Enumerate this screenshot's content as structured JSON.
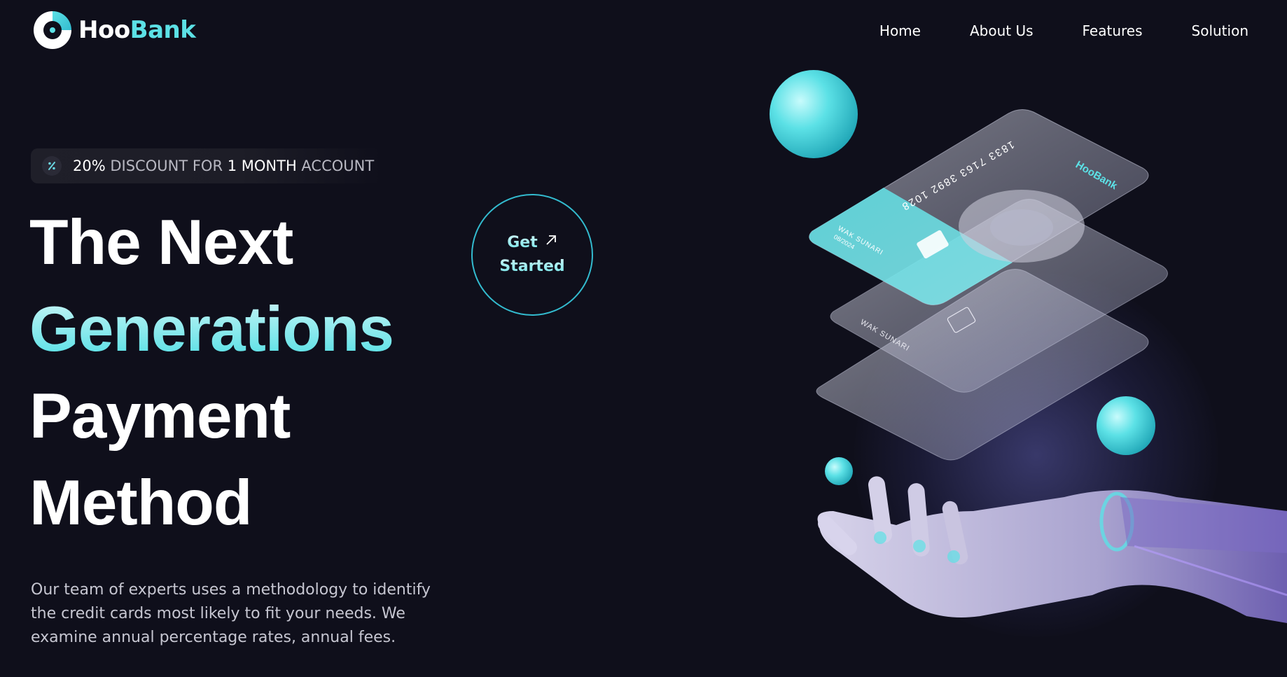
{
  "brand": {
    "name_part1": "Hoo",
    "name_part2": "Bank"
  },
  "nav": {
    "items": [
      {
        "label": "Home"
      },
      {
        "label": "About Us"
      },
      {
        "label": "Features"
      },
      {
        "label": "Solution"
      }
    ]
  },
  "discount": {
    "value": "20%",
    "text1": " DISCOUNT FOR ",
    "months": "1 MONTH",
    "text2": " ACCOUNT",
    "icon": "percent-discount-icon"
  },
  "hero": {
    "line1": "The Next",
    "line2": "Generations",
    "line3": "Payment",
    "line4": "Method",
    "description": "Our team of experts uses a methodology to identify the credit cards most likely to fit your needs. We examine annual percentage rates, annual fees."
  },
  "cta": {
    "line1": "Get",
    "line2": "Started",
    "icon": "arrow-up-right-icon"
  },
  "card_art": {
    "card_number": "1833 7163 3892 1028",
    "card_brand": "HooBank",
    "holder_name": "WAK SUNARI",
    "expiry": "08/2024"
  },
  "colors": {
    "background": "#0f0f1b",
    "accent": "#5ce1e6",
    "accent_dark": "#33bbcf"
  }
}
